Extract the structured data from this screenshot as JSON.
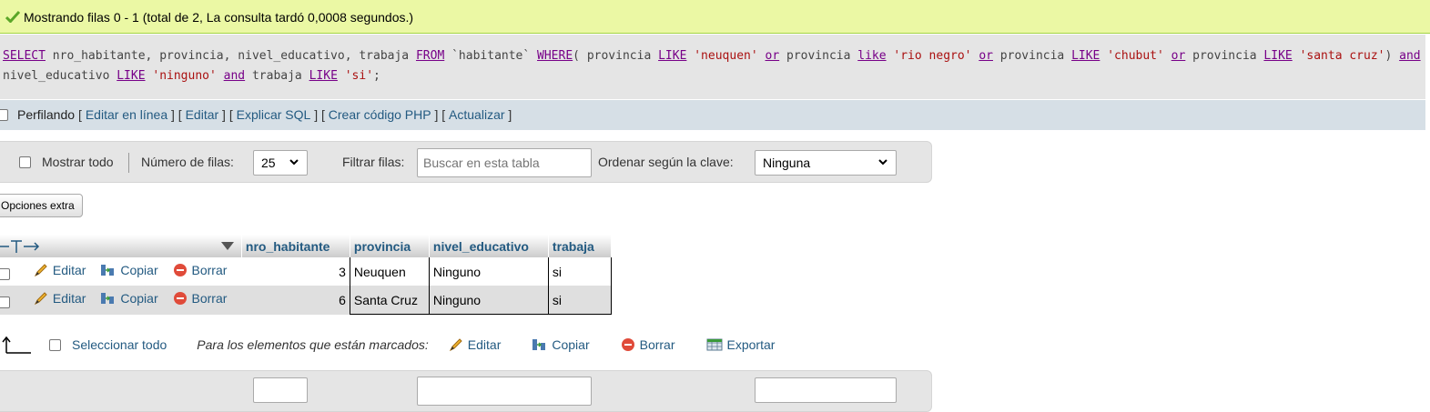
{
  "success": {
    "message": "Mostrando filas 0 - 1 (total de 2, La consulta tardó 0,0008 segundos.)"
  },
  "sql": {
    "t1": "SELECT",
    "t2": " nro_habitante, provincia, nivel_educativo, trabaja ",
    "t3": "FROM",
    "t4": " `habitante` ",
    "t5": "WHERE",
    "t6": "( provincia ",
    "t7": "LIKE",
    "t8": " ",
    "t9": "'neuquen'",
    "t10": " ",
    "t11": "or",
    "t12": " provincia ",
    "t13": "like",
    "t14": " ",
    "t15": "'rio negro'",
    "t16": " ",
    "t17": "or",
    "t18": " provincia ",
    "t19": "LIKE",
    "t20": " ",
    "t21": "'chubut'",
    "t22": " ",
    "t23": "or",
    "t24": " provincia ",
    "t25": "LIKE",
    "t26": " ",
    "t27": "'santa cruz'",
    "t28": ") ",
    "t29": "and",
    "t30": " nivel_educativo ",
    "t31": "LIKE",
    "t32": " ",
    "t33": "'ninguno'",
    "t34": " ",
    "t35": "and",
    "t36": " trabaja ",
    "t37": "LIKE",
    "t38": " ",
    "t39": "'si'",
    "t40": ";"
  },
  "profiling": {
    "label": "Perfilando",
    "links": [
      "Editar en línea",
      "Editar",
      "Explicar SQL",
      "Crear código PHP",
      "Actualizar"
    ]
  },
  "nav": {
    "show_all": "Mostrar todo",
    "rows_label": "Número de filas:",
    "rows_value": "25",
    "filter_label": "Filtrar filas:",
    "filter_placeholder": "Buscar en esta tabla",
    "sort_label": "Ordenar según la clave:",
    "sort_value": "Ninguna"
  },
  "extra_options": "Opciones extra",
  "table": {
    "columns": [
      "nro_habitante",
      "provincia",
      "nivel_educativo",
      "trabaja"
    ],
    "actions": {
      "edit": "Editar",
      "copy": "Copiar",
      "delete": "Borrar"
    },
    "rows": [
      {
        "nro_habitante": "3",
        "provincia": "Neuquen",
        "nivel_educativo": "Ninguno",
        "trabaja": "si"
      },
      {
        "nro_habitante": "6",
        "provincia": "Santa Cruz",
        "nivel_educativo": "Ninguno",
        "trabaja": "si"
      }
    ]
  },
  "bulk": {
    "select_all": "Seleccionar todo",
    "marked_label": "Para los elementos que están marcados:",
    "edit": "Editar",
    "copy": "Copiar",
    "delete": "Borrar",
    "export": "Exportar"
  },
  "colors": {
    "link": "#235a81",
    "success_bg": "#ebf8a4",
    "keyword": "#770088",
    "string": "#aa1111"
  },
  "icons": [
    "check-icon",
    "pencil-icon",
    "copy-icon",
    "delete-icon",
    "export-icon",
    "sort-arrow-icon",
    "arrow-up-corner-icon",
    "chevron-down-icon"
  ]
}
